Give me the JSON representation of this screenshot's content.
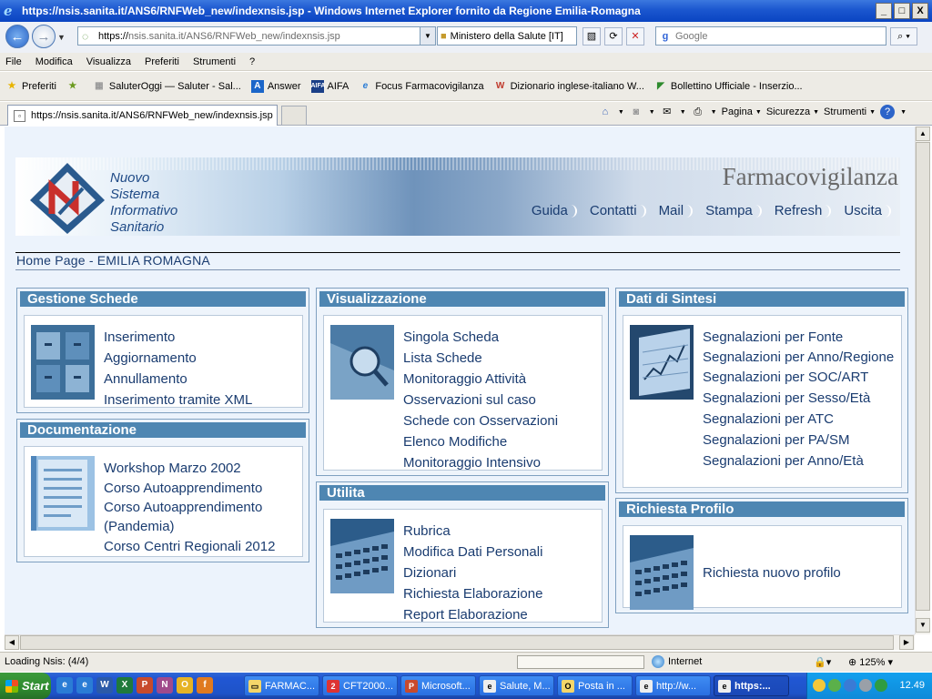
{
  "window": {
    "title": "https://nsis.sanita.it/ANS6/RNFWeb_new/indexnsis.jsp - Windows Internet Explorer fornito da Regione Emilia-Romagna",
    "controls": [
      "_",
      "□",
      "X"
    ]
  },
  "address": {
    "proto": "https://",
    "rest": "nsis.sanita.it/ANS6/RNFWeb_new/indexnsis.jsp",
    "cert": "Ministero della Salute [IT]",
    "search_placeholder": "Google"
  },
  "menu": [
    "File",
    "Modifica",
    "Visualizza",
    "Preferiti",
    "Strumenti",
    "?"
  ],
  "favorites": {
    "label": "Preferiti",
    "items": [
      "SaluterOggi — Saluter - Sal...",
      "Answer",
      "AIFA",
      "Focus Farmacovigilanza",
      "Dizionario inglese-italiano W...",
      "Bollettino Ufficiale - Inserzio..."
    ]
  },
  "tab": {
    "title": "https://nsis.sanita.it/ANS6/RNFWeb_new/indexnsis.jsp"
  },
  "commands": [
    "Pagina",
    "Sicurezza",
    "Strumenti"
  ],
  "status": {
    "message": "Loading Nsis: (4/4)",
    "zone": "Internet",
    "zoom": "125%"
  },
  "taskbar": {
    "start": "Start",
    "tasks": [
      "FARMAC...",
      "CFT2000...",
      "Microsoft...",
      "Salute, M...",
      "Posta in ...",
      "http://w...",
      "https:..."
    ],
    "clock": "12.49"
  },
  "page": {
    "logo_lines": [
      "Nuovo",
      "Sistema",
      "Informativo",
      "Sanitario"
    ],
    "site_title": "Farmacovigilanza",
    "nav": [
      "Guida",
      "Contatti",
      "Mail",
      "Stampa",
      "Refresh",
      "Uscita"
    ],
    "breadcrumb": "Home Page - EMILIA ROMAGNA",
    "gestione": {
      "title": "Gestione Schede",
      "links": [
        "Inserimento",
        "Aggiornamento",
        "Annullamento",
        "Inserimento tramite XML"
      ]
    },
    "documentazione": {
      "title": "Documentazione",
      "links": [
        "Workshop Marzo 2002",
        "Corso Autoapprendimento",
        "Corso Autoapprendimento (Pandemia)",
        "Corso Centri Regionali 2012"
      ]
    },
    "visualizzazione": {
      "title": "Visualizzazione",
      "links": [
        "Singola Scheda",
        "Lista Schede",
        "Monitoraggio Attività",
        "Osservazioni sul caso",
        "Schede con Osservazioni",
        "Elenco Modifiche",
        "Monitoraggio Intensivo"
      ]
    },
    "utilita": {
      "title": "Utilita",
      "links": [
        "Rubrica",
        "Modifica Dati Personali",
        "Dizionari",
        "Richiesta Elaborazione",
        "Report Elaborazione"
      ]
    },
    "sintesi": {
      "title": "Dati di Sintesi",
      "links": [
        "Segnalazioni per Fonte",
        "Segnalazioni per Anno/Regione",
        "Segnalazioni per SOC/ART",
        "Segnalazioni per Sesso/Età",
        "Segnalazioni per ATC",
        "Segnalazioni per PA/SM",
        "Segnalazioni per Anno/Età"
      ]
    },
    "profilo": {
      "title": "Richiesta Profilo",
      "links": [
        "Richiesta nuovo profilo"
      ]
    }
  }
}
